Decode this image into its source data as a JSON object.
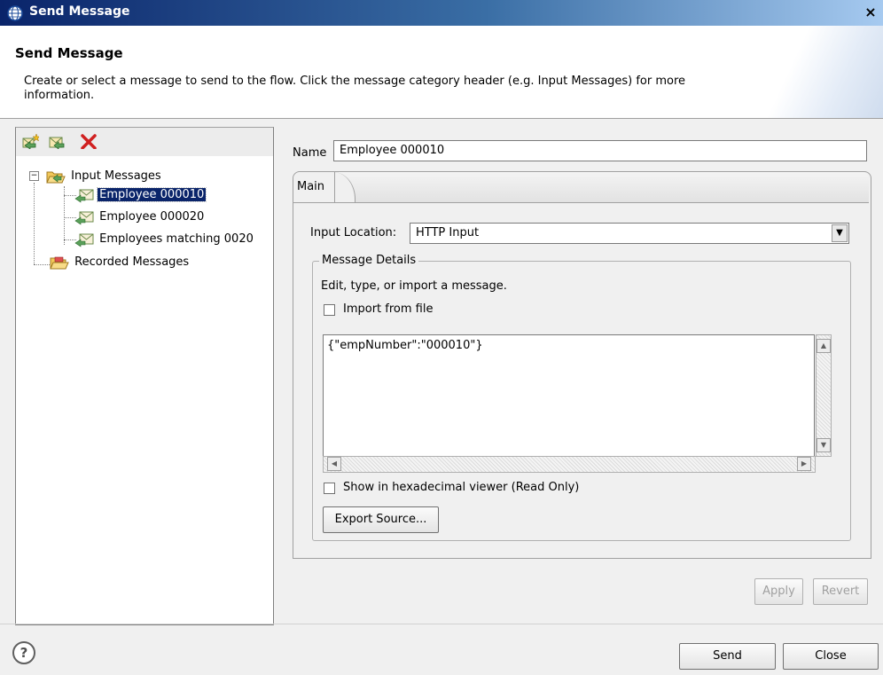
{
  "window": {
    "title": "Send Message",
    "close_glyph": "×"
  },
  "header": {
    "title": "Send Message",
    "description": "Create or select a message to send to the flow. Click the message category header (e.g. Input Messages) for more information."
  },
  "toolbar": {
    "icons": [
      "new-message-icon",
      "new-folder-icon",
      "delete-icon"
    ]
  },
  "tree": {
    "input_messages_label": "Input Messages",
    "items": [
      {
        "label": "Employee 000010",
        "selected": true
      },
      {
        "label": "Employee 000020",
        "selected": false
      },
      {
        "label": "Employees matching 0020",
        "selected": false
      }
    ],
    "recorded_messages_label": "Recorded Messages"
  },
  "form": {
    "name_label": "Name",
    "name_value": "Employee 000010",
    "tab_main_label": "Main",
    "input_location_label": "Input Location:",
    "input_location_value": "HTTP Input",
    "message_details_legend": "Message Details",
    "message_details_subtitle": "Edit, type, or import a message.",
    "import_from_file_label": "Import from file",
    "message_body": "{\"empNumber\":\"000010\"}",
    "hex_viewer_label": "Show in hexadecimal viewer (Read Only)",
    "export_source_label": "Export Source...",
    "apply_label": "Apply",
    "revert_label": "Revert"
  },
  "footer": {
    "help_glyph": "?",
    "send_label": "Send",
    "close_label": "Close"
  }
}
